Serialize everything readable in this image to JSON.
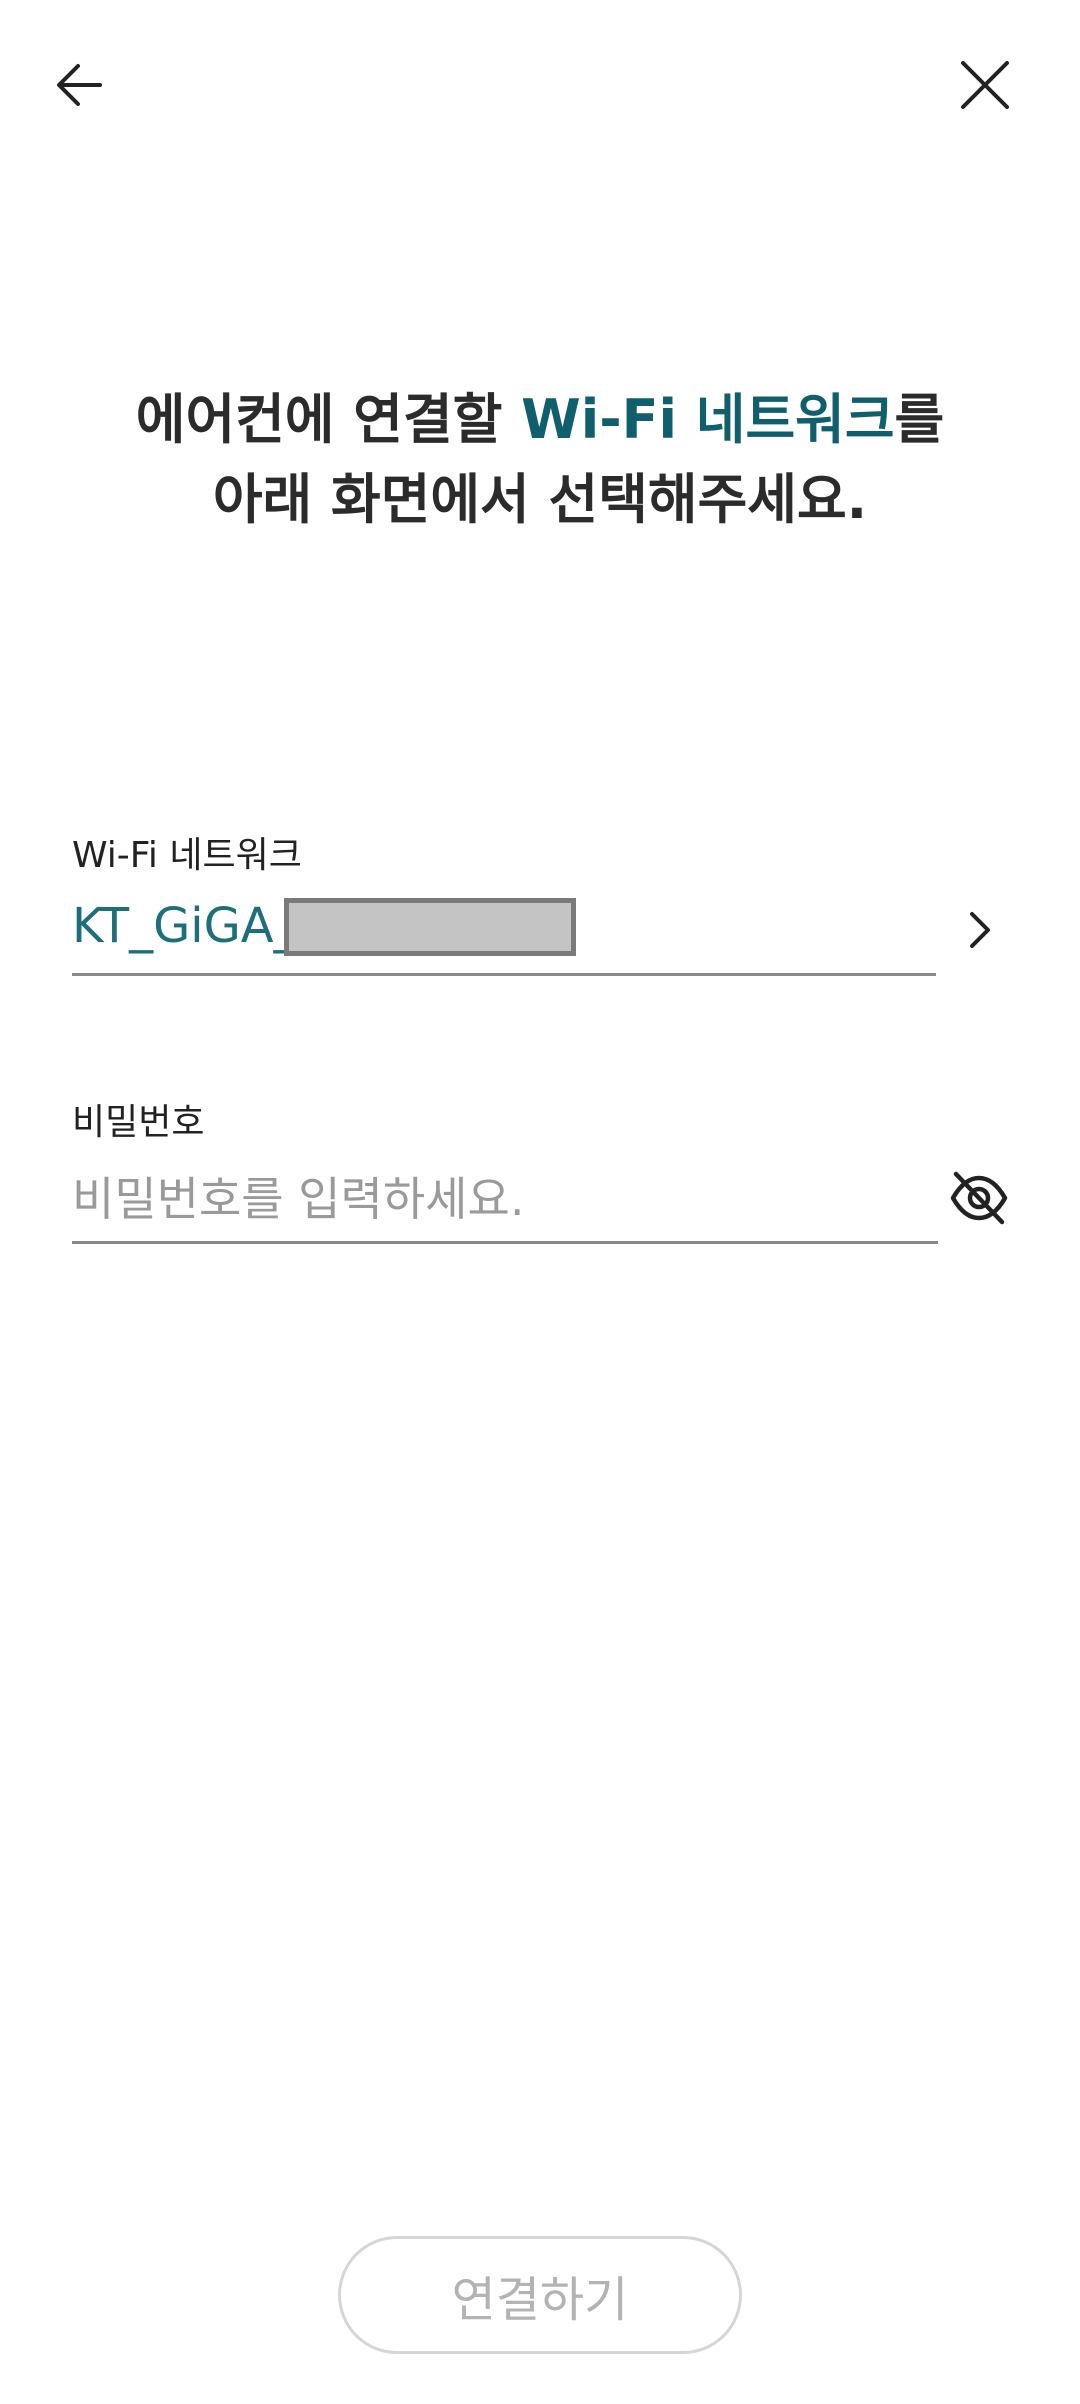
{
  "header": {
    "back_icon": "arrow-left-icon",
    "close_icon": "close-icon"
  },
  "headline": {
    "line1_before": "에어컨에 연결할 ",
    "line1_accent": "Wi-Fi 네트워크",
    "line1_after": "를",
    "line2": "아래 화면에서 선택해주세요.",
    "accent_color": "#0f5f6c"
  },
  "wifi": {
    "label": "Wi-Fi 네트워크",
    "value": "KT_GiGA_",
    "value_color": "#1d6f7b",
    "chevron_icon": "chevron-right-icon"
  },
  "password": {
    "label": "비밀번호",
    "placeholder": "비밀번호를 입력하세요.",
    "value": "",
    "visibility_icon": "eye-off-icon"
  },
  "connect_button": {
    "label": "연결하기",
    "enabled": false
  }
}
